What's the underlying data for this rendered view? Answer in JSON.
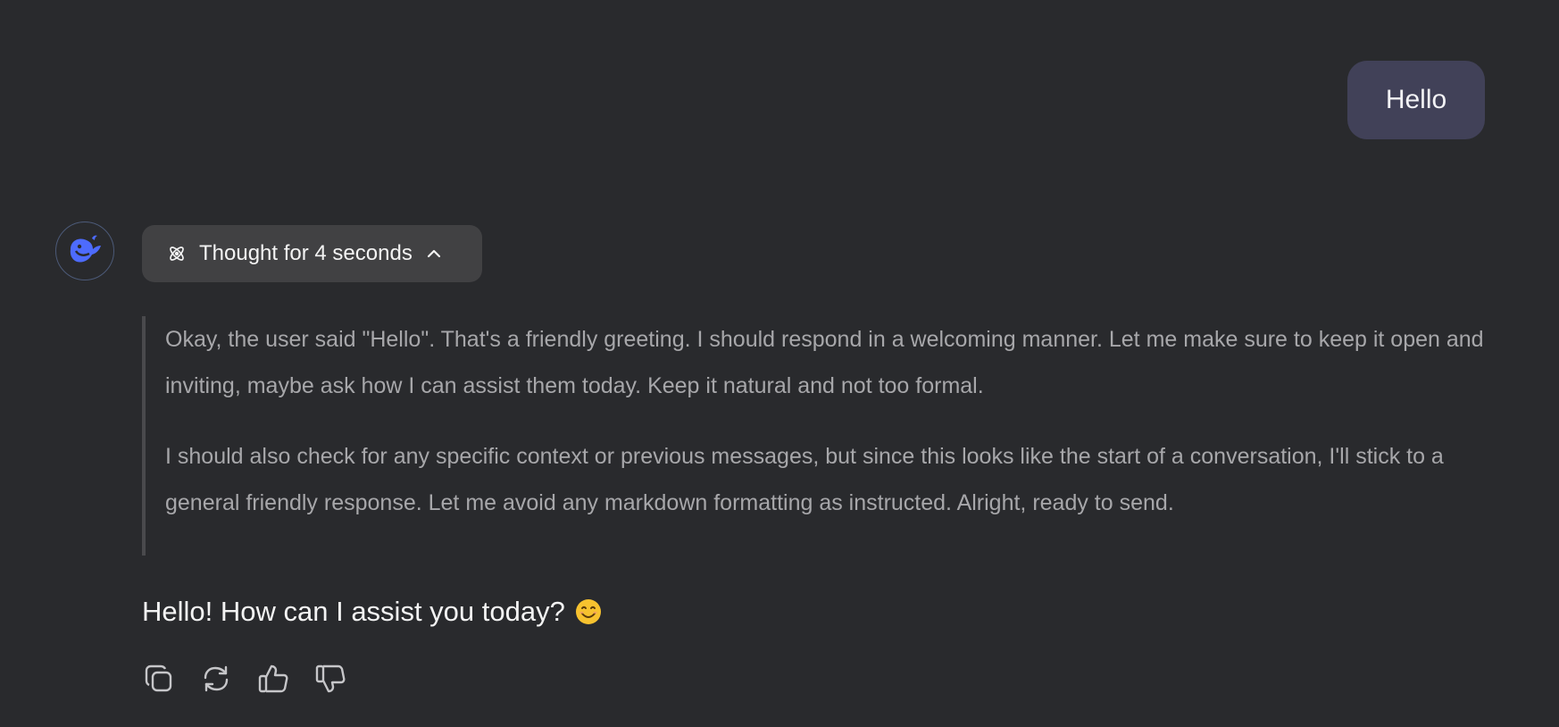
{
  "user_message": {
    "text": "Hello"
  },
  "assistant": {
    "avatar_icon": "deepseek-whale-icon",
    "thinking": {
      "toggle_label": "Thought for 4 seconds",
      "toggle_icon": "atom-icon",
      "state_icon": "chevron-up-icon",
      "paragraphs": [
        "Okay, the user said \"Hello\". That's a friendly greeting. I should respond in a welcoming manner. Let me make sure to keep it open and inviting, maybe ask how I can assist them today. Keep it natural and not too formal.",
        "I should also check for any specific context or previous messages, but since this looks like the start of a conversation, I'll stick to a general friendly response. Let me avoid any markdown formatting as instructed. Alright, ready to send."
      ]
    },
    "answer": "Hello! How can I assist you today?",
    "answer_emoji": "smiling-face-icon",
    "actions": [
      "copy-icon",
      "regenerate-icon",
      "thumbs-up-icon",
      "thumbs-down-icon"
    ]
  },
  "colors": {
    "background": "#292a2d",
    "user_bubble": "#414158",
    "accent_blue": "#4d6bfe",
    "thought_text": "#a7a7aa"
  }
}
